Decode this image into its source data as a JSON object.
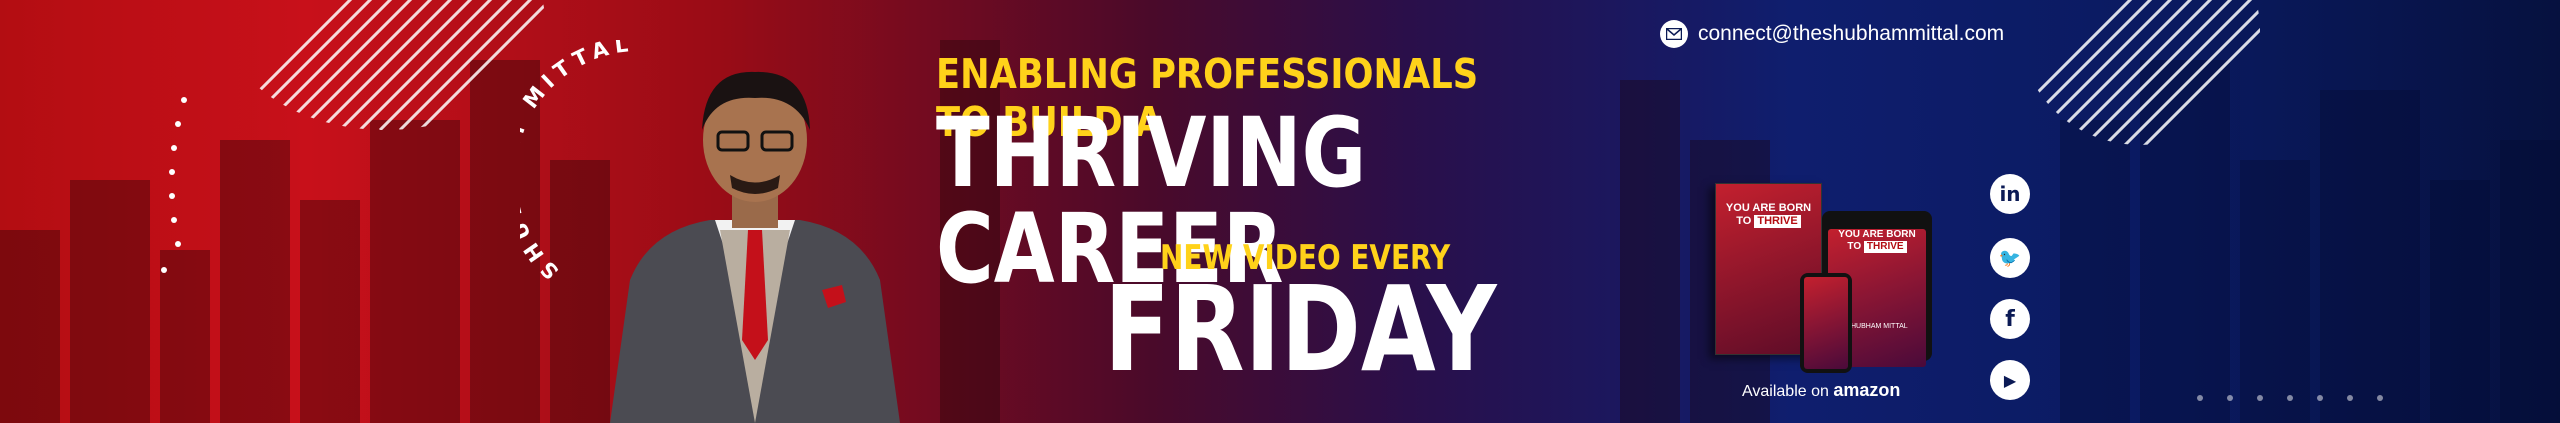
{
  "banner": {
    "name_arc": "SHUBHAM MITTAL",
    "headline_top": "ENABLING PROFESSIONALS TO BUILD A",
    "headline_main": "THRIVING CAREER",
    "schedule_top": "NEW VIDEO EVERY",
    "schedule_day": "FRIDAY",
    "email": "connect@theshubhammittal.com"
  },
  "book": {
    "title_line1": "YOU ARE BORN",
    "title_line2": "TO",
    "title_highlight": "THRIVE",
    "author": "SHUBHAM MITTAL",
    "available_text": "Available on",
    "store": "amazon"
  },
  "social": [
    {
      "icon": "linkedin-icon",
      "glyph": "in"
    },
    {
      "icon": "twitter-icon",
      "glyph": "🐦"
    },
    {
      "icon": "facebook-icon",
      "glyph": "f"
    },
    {
      "icon": "youtube-icon",
      "glyph": "▶"
    }
  ],
  "colors": {
    "accent_yellow": "#ffd21a",
    "red": "#c8101a",
    "navy": "#0a1a60"
  }
}
